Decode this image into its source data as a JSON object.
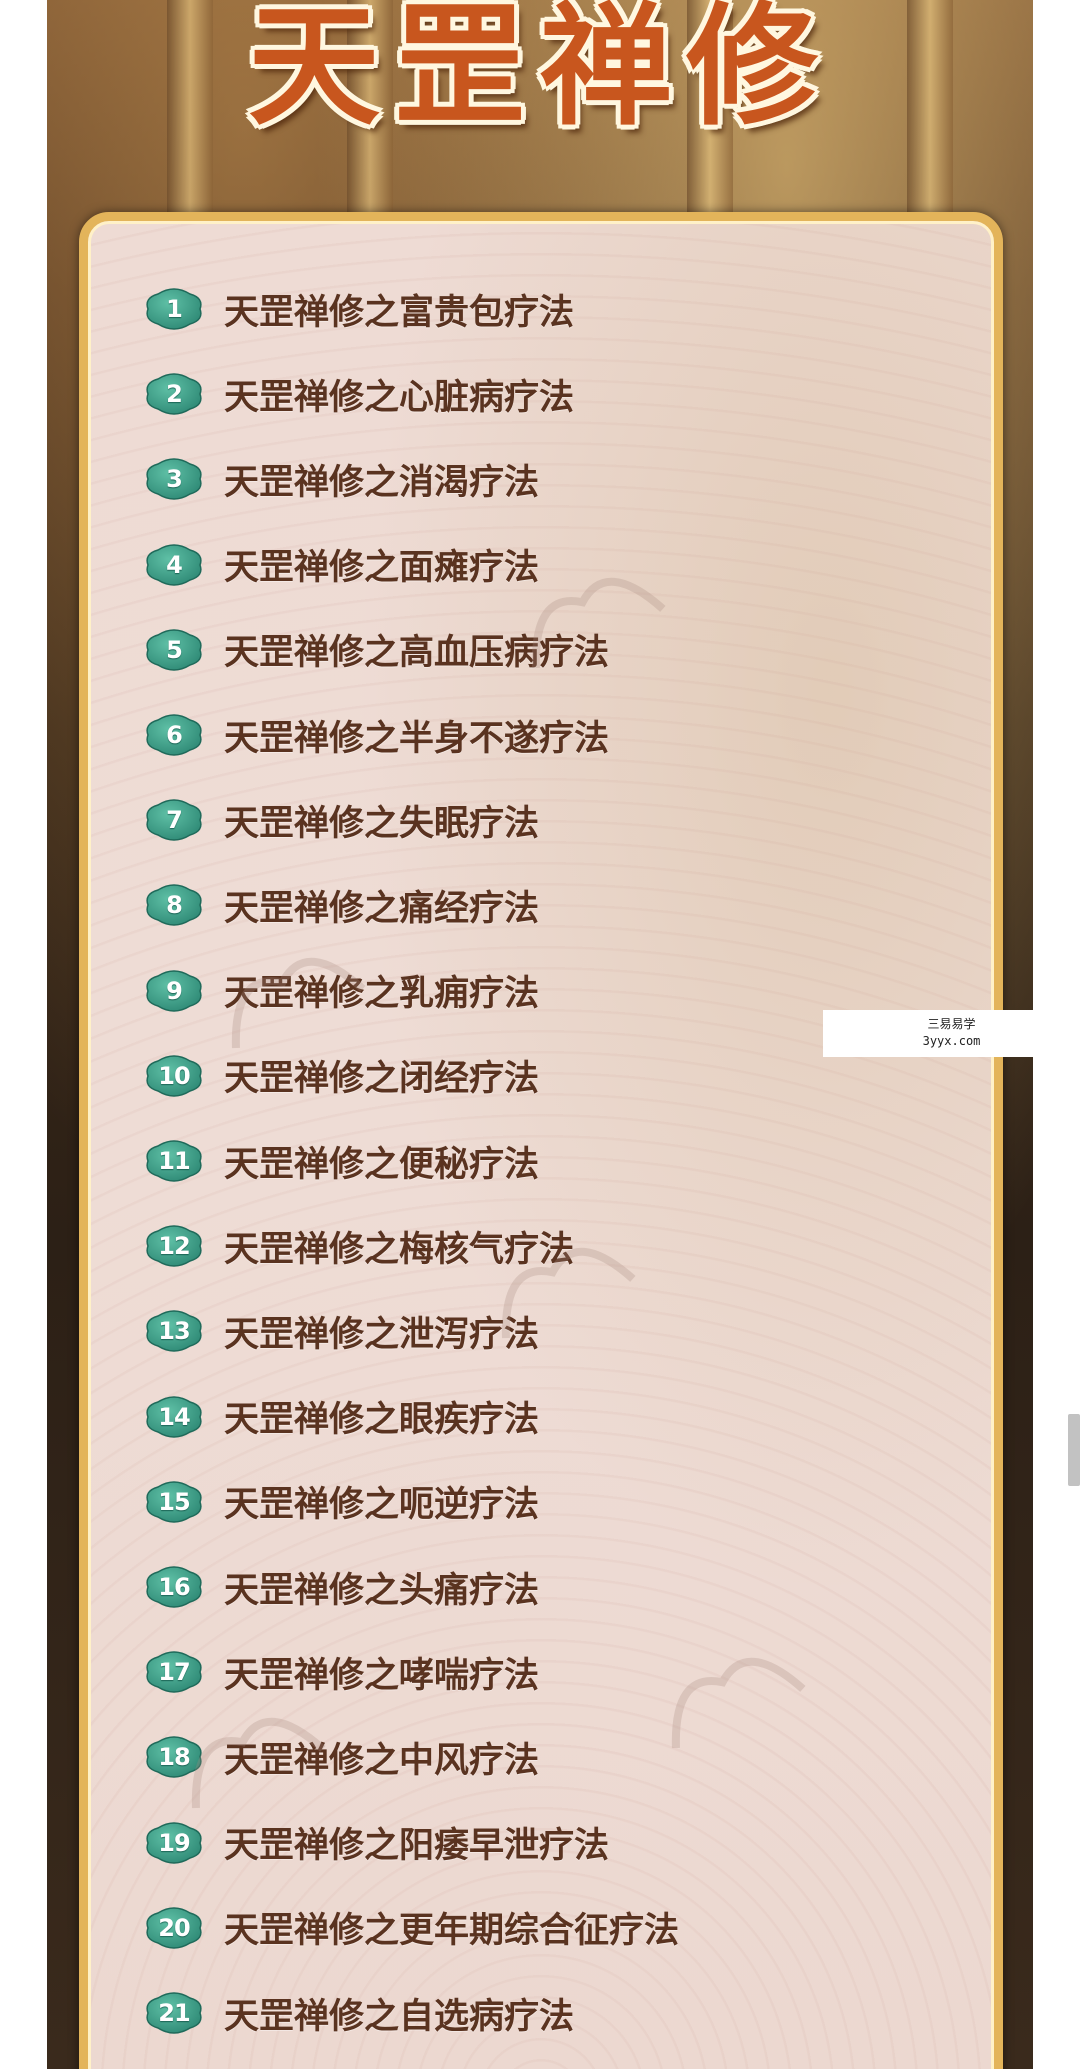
{
  "title": "天罡禅修",
  "items": [
    {
      "num": "1",
      "label": "天罡禅修之富贵包疗法"
    },
    {
      "num": "2",
      "label": "天罡禅修之心脏病疗法"
    },
    {
      "num": "3",
      "label": "天罡禅修之消渴疗法"
    },
    {
      "num": "4",
      "label": "天罡禅修之面瘫疗法"
    },
    {
      "num": "5",
      "label": "天罡禅修之高血压病疗法"
    },
    {
      "num": "6",
      "label": "天罡禅修之半身不遂疗法"
    },
    {
      "num": "7",
      "label": "天罡禅修之失眠疗法"
    },
    {
      "num": "8",
      "label": "天罡禅修之痛经疗法"
    },
    {
      "num": "9",
      "label": "天罡禅修之乳痈疗法"
    },
    {
      "num": "10",
      "label": "天罡禅修之闭经疗法"
    },
    {
      "num": "11",
      "label": "天罡禅修之便秘疗法"
    },
    {
      "num": "12",
      "label": "天罡禅修之梅核气疗法"
    },
    {
      "num": "13",
      "label": "天罡禅修之泄泻疗法"
    },
    {
      "num": "14",
      "label": "天罡禅修之眼疾疗法"
    },
    {
      "num": "15",
      "label": "天罡禅修之呃逆疗法"
    },
    {
      "num": "16",
      "label": "天罡禅修之头痛疗法"
    },
    {
      "num": "17",
      "label": "天罡禅修之哮喘疗法"
    },
    {
      "num": "18",
      "label": "天罡禅修之中风疗法"
    },
    {
      "num": "19",
      "label": "天罡禅修之阳痿早泄疗法"
    },
    {
      "num": "20",
      "label": "天罡禅修之更年期综合征疗法"
    },
    {
      "num": "21",
      "label": "天罡禅修之自选病疗法"
    }
  ],
  "side_watermark": {
    "line1": "三易易学",
    "line2": "3yyx.com"
  },
  "colors": {
    "badge": "#2f8a76",
    "title": "#c8561e",
    "frame": "#e3b45a",
    "text": "#5a3320"
  }
}
